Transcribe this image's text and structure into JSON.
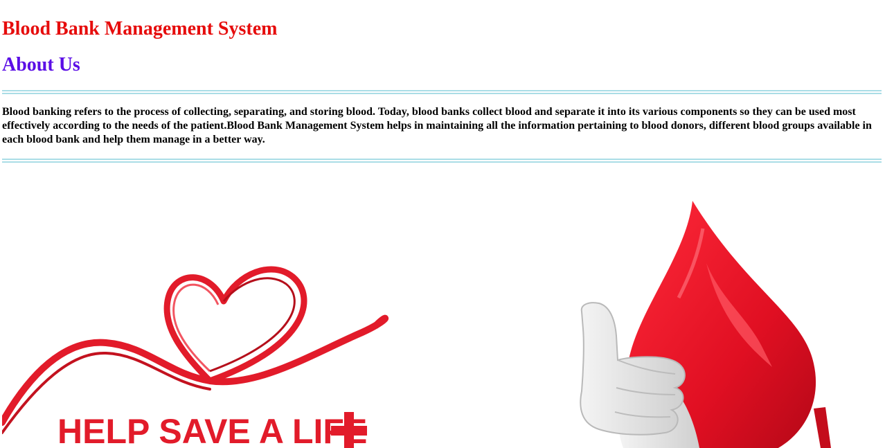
{
  "header": {
    "site_title": "Blood Bank Management System",
    "section_title": "About Us"
  },
  "about": {
    "text": "Blood banking refers to the process of collecting, separating, and storing blood. Today, blood banks collect blood and separate it into its various components so they can be used most effectively according to the needs of the patient.Blood Bank Management System helps in maintaining all the information pertaining to blood donors, different blood groups available in each blood bank and help them manage in a better way."
  },
  "images": {
    "left_banner_text": "HELP SAVE A LIFE",
    "left_icon": "heart-ribbon-icon",
    "right_icon": "blood-drop-thumbs-up-icon"
  },
  "colors": {
    "site_title": "#e60c0c",
    "section_title": "#5b0ee6",
    "rule": "#aadde6",
    "brand_red": "#e21b2a"
  }
}
